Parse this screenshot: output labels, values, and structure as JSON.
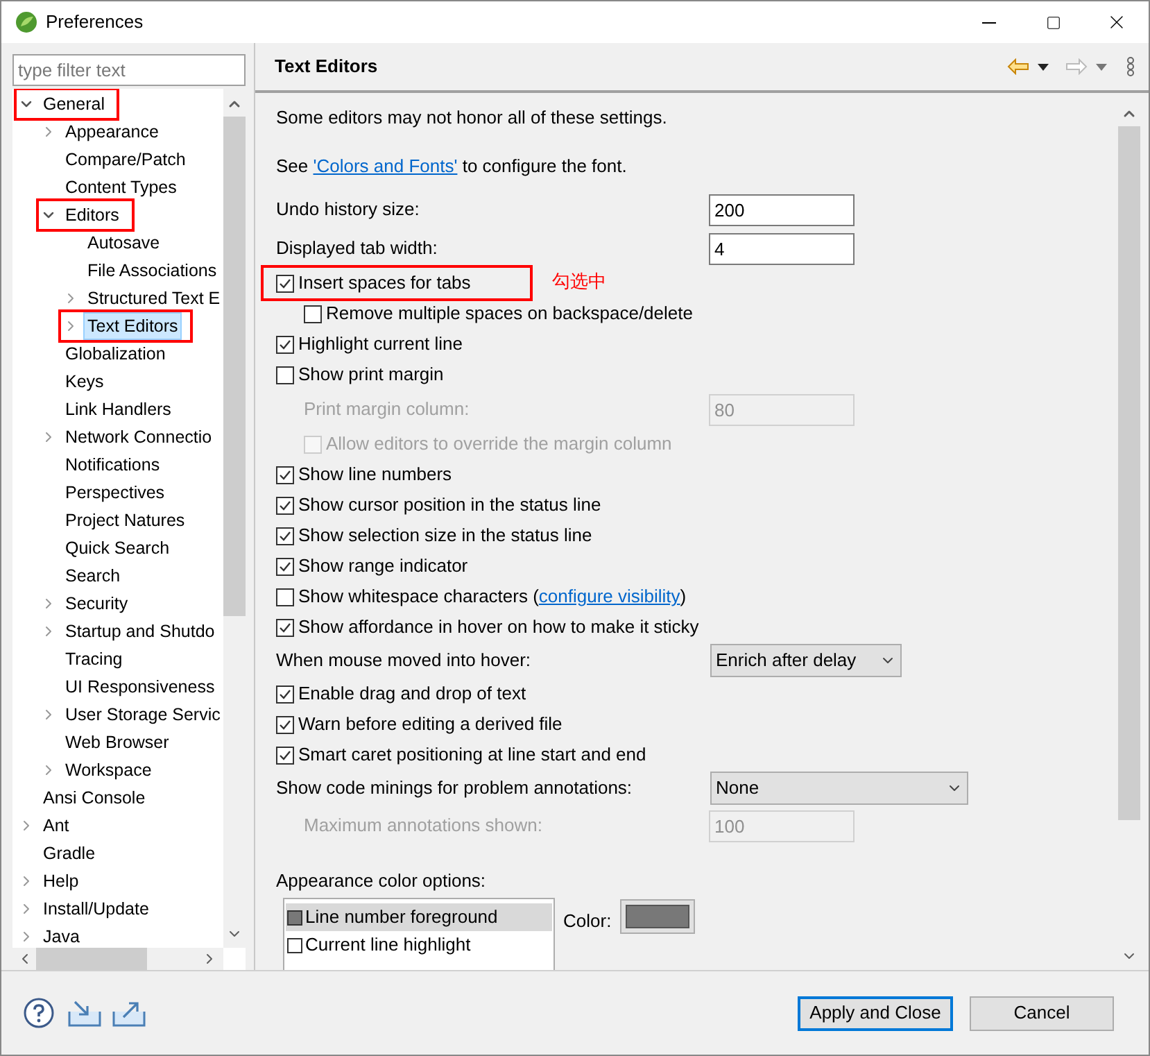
{
  "window": {
    "title": "Preferences"
  },
  "filter": {
    "placeholder": "type filter text"
  },
  "tree": [
    {
      "label": "General",
      "expandable": true,
      "expanded": true,
      "selected": false,
      "highlighted": true,
      "children": [
        {
          "label": "Appearance",
          "expandable": true,
          "expanded": false,
          "selected": false,
          "highlighted": false
        },
        {
          "label": "Compare/Patch",
          "expandable": false,
          "selected": false,
          "highlighted": false
        },
        {
          "label": "Content Types",
          "expandable": false,
          "selected": false,
          "highlighted": false
        },
        {
          "label": "Editors",
          "expandable": true,
          "expanded": true,
          "selected": false,
          "highlighted": true,
          "children": [
            {
              "label": "Autosave",
              "expandable": false,
              "selected": false,
              "highlighted": false
            },
            {
              "label": "File Associations",
              "expandable": false,
              "selected": false,
              "highlighted": false
            },
            {
              "label": "Structured Text E",
              "expandable": true,
              "expanded": false,
              "selected": false,
              "highlighted": false
            },
            {
              "label": "Text Editors",
              "expandable": true,
              "expanded": false,
              "selected": true,
              "highlighted": true
            }
          ]
        },
        {
          "label": "Globalization",
          "expandable": false,
          "selected": false,
          "highlighted": false
        },
        {
          "label": "Keys",
          "expandable": false,
          "selected": false,
          "highlighted": false
        },
        {
          "label": "Link Handlers",
          "expandable": false,
          "selected": false,
          "highlighted": false
        },
        {
          "label": "Network Connectio",
          "expandable": true,
          "expanded": false,
          "selected": false,
          "highlighted": false
        },
        {
          "label": "Notifications",
          "expandable": false,
          "selected": false,
          "highlighted": false
        },
        {
          "label": "Perspectives",
          "expandable": false,
          "selected": false,
          "highlighted": false
        },
        {
          "label": "Project Natures",
          "expandable": false,
          "selected": false,
          "highlighted": false
        },
        {
          "label": "Quick Search",
          "expandable": false,
          "selected": false,
          "highlighted": false
        },
        {
          "label": "Search",
          "expandable": false,
          "selected": false,
          "highlighted": false
        },
        {
          "label": "Security",
          "expandable": true,
          "expanded": false,
          "selected": false,
          "highlighted": false
        },
        {
          "label": "Startup and Shutdo",
          "expandable": true,
          "expanded": false,
          "selected": false,
          "highlighted": false
        },
        {
          "label": "Tracing",
          "expandable": false,
          "selected": false,
          "highlighted": false
        },
        {
          "label": "UI Responsiveness",
          "expandable": false,
          "selected": false,
          "highlighted": false
        },
        {
          "label": "User Storage Servic",
          "expandable": true,
          "expanded": false,
          "selected": false,
          "highlighted": false
        },
        {
          "label": "Web Browser",
          "expandable": false,
          "selected": false,
          "highlighted": false
        },
        {
          "label": "Workspace",
          "expandable": true,
          "expanded": false,
          "selected": false,
          "highlighted": false
        }
      ]
    },
    {
      "label": "Ansi Console",
      "expandable": false,
      "selected": false,
      "highlighted": false
    },
    {
      "label": "Ant",
      "expandable": true,
      "expanded": false,
      "selected": false,
      "highlighted": false
    },
    {
      "label": "Gradle",
      "expandable": false,
      "selected": false,
      "highlighted": false
    },
    {
      "label": "Help",
      "expandable": true,
      "expanded": false,
      "selected": false,
      "highlighted": false
    },
    {
      "label": "Install/Update",
      "expandable": true,
      "expanded": false,
      "selected": false,
      "highlighted": false
    },
    {
      "label": "Java",
      "expandable": true,
      "expanded": false,
      "selected": false,
      "highlighted": false
    }
  ],
  "page": {
    "title": "Text Editors",
    "settings": [
      {
        "kind": "text",
        "parts": [
          {
            "text": "Some editors may not honor all of these settings.",
            "link": false
          }
        ]
      },
      {
        "kind": "text",
        "parts": [
          {
            "text": "See ",
            "link": false
          },
          {
            "text": "'Colors and Fonts'",
            "link": true
          },
          {
            "text": " to configure the font.",
            "link": false
          }
        ]
      },
      {
        "kind": "field",
        "label": "Undo history size:",
        "value": "200",
        "disabled": false
      },
      {
        "kind": "field",
        "label": "Displayed tab width:",
        "value": "4",
        "disabled": false
      },
      {
        "kind": "checkbox",
        "parts": [
          {
            "text": "Insert spaces for tabs",
            "link": false
          }
        ],
        "checked": true,
        "disabled": false,
        "highlighted": true,
        "note": "勾选中",
        "children": [
          {
            "kind": "checkbox",
            "parts": [
              {
                "text": "Remove multiple spaces on backspace/delete",
                "link": false
              }
            ],
            "checked": false,
            "disabled": false,
            "highlighted": false
          }
        ]
      },
      {
        "kind": "checkbox",
        "parts": [
          {
            "text": "Highlight current line",
            "link": false
          }
        ],
        "checked": true,
        "disabled": false,
        "highlighted": false
      },
      {
        "kind": "checkbox",
        "parts": [
          {
            "text": "Show print margin",
            "link": false
          }
        ],
        "checked": false,
        "disabled": false,
        "highlighted": false,
        "children": [
          {
            "kind": "field",
            "label": "Print margin column:",
            "value": "80",
            "disabled": true
          },
          {
            "kind": "checkbox",
            "parts": [
              {
                "text": "Allow editors to override the margin column",
                "link": false
              }
            ],
            "checked": false,
            "disabled": true,
            "highlighted": false
          }
        ]
      },
      {
        "kind": "checkbox",
        "parts": [
          {
            "text": "Show line numbers",
            "link": false
          }
        ],
        "checked": true,
        "disabled": false,
        "highlighted": false
      },
      {
        "kind": "checkbox",
        "parts": [
          {
            "text": "Show cursor position in the status line",
            "link": false
          }
        ],
        "checked": true,
        "disabled": false,
        "highlighted": false
      },
      {
        "kind": "checkbox",
        "parts": [
          {
            "text": "Show selection size in the status line",
            "link": false
          }
        ],
        "checked": true,
        "disabled": false,
        "highlighted": false
      },
      {
        "kind": "checkbox",
        "parts": [
          {
            "text": "Show range indicator",
            "link": false
          }
        ],
        "checked": true,
        "disabled": false,
        "highlighted": false
      },
      {
        "kind": "checkbox",
        "parts": [
          {
            "text": "Show whitespace characters (",
            "link": false
          },
          {
            "text": "configure visibility",
            "link": true
          },
          {
            "text": ")",
            "link": false
          }
        ],
        "checked": false,
        "disabled": false,
        "highlighted": false
      },
      {
        "kind": "checkbox",
        "parts": [
          {
            "text": "Show affordance in hover on how to make it sticky",
            "link": false
          }
        ],
        "checked": true,
        "disabled": false,
        "highlighted": false
      },
      {
        "kind": "select",
        "label": "When mouse moved into hover:",
        "value": "Enrich after delay",
        "wide": false
      },
      {
        "kind": "checkbox",
        "parts": [
          {
            "text": "Enable drag and drop of text",
            "link": false
          }
        ],
        "checked": true,
        "disabled": false,
        "highlighted": false
      },
      {
        "kind": "checkbox",
        "parts": [
          {
            "text": "Warn before editing a derived file",
            "link": false
          }
        ],
        "checked": true,
        "disabled": false,
        "highlighted": false
      },
      {
        "kind": "checkbox",
        "parts": [
          {
            "text": "Smart caret positioning at line start and end",
            "link": false
          }
        ],
        "checked": true,
        "disabled": false,
        "highlighted": false
      },
      {
        "kind": "select",
        "label": "Show code minings for problem annotations:",
        "value": "None",
        "wide": true,
        "children": [
          {
            "kind": "field",
            "label": "Maximum annotations shown:",
            "value": "100",
            "disabled": true
          }
        ]
      }
    ],
    "colors": {
      "label": "Appearance color options:",
      "items": [
        {
          "label": "Line number foreground",
          "selected": true,
          "color": "#787878"
        },
        {
          "label": "Current line highlight",
          "selected": false,
          "color": "#ffffff"
        }
      ],
      "color_label": "Color:",
      "color": "#787878"
    }
  },
  "buttons": [
    {
      "label": "Apply and Close",
      "default": true
    },
    {
      "label": "Cancel",
      "default": false
    }
  ]
}
